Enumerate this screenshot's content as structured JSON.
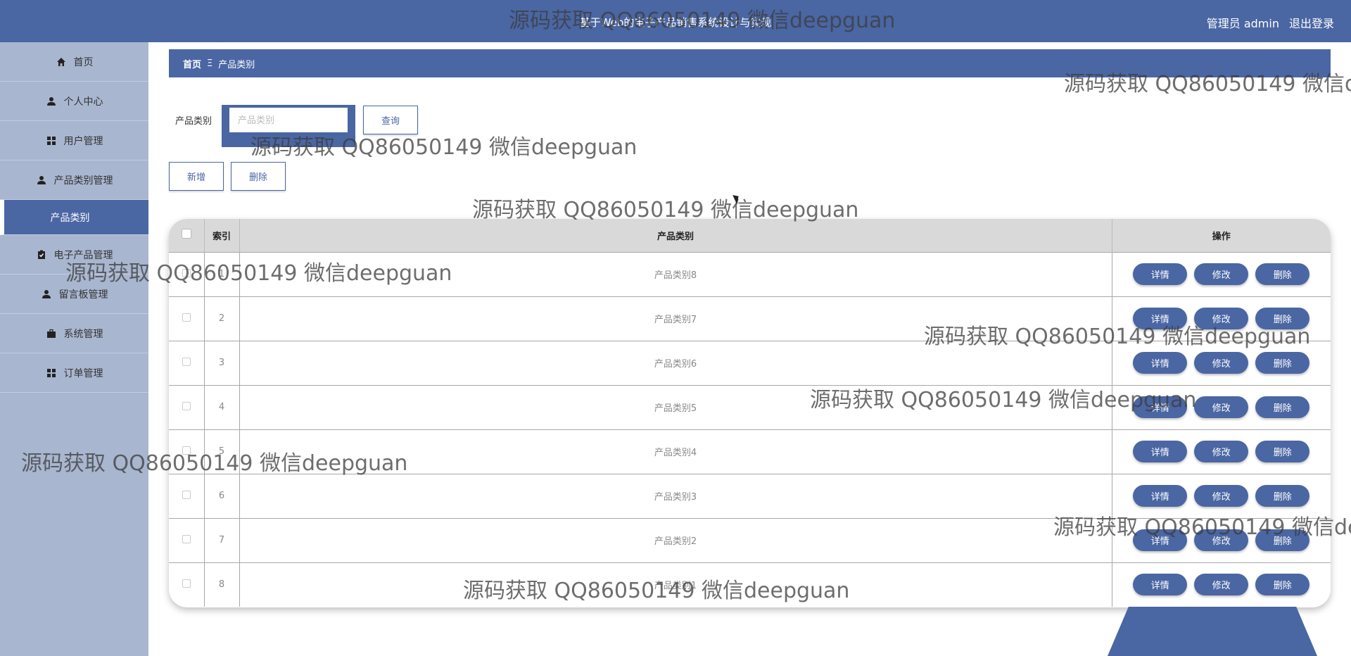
{
  "header": {
    "title": "基于Web的电子产品销售系统设计与实现",
    "user": "管理员 admin",
    "logout": "退出登录"
  },
  "sidebar": {
    "items": [
      {
        "label": "首页",
        "icon": "home-icon"
      },
      {
        "label": "个人中心",
        "icon": "user-icon"
      },
      {
        "label": "用户管理",
        "icon": "grid-icon"
      },
      {
        "label": "产品类别管理",
        "icon": "user-icon"
      },
      {
        "label": "产品类别",
        "icon": "",
        "active": true
      },
      {
        "label": "电子产品管理",
        "icon": "clipboard-icon"
      },
      {
        "label": "留言板管理",
        "icon": "user-icon"
      },
      {
        "label": "系统管理",
        "icon": "briefcase-icon"
      },
      {
        "label": "订单管理",
        "icon": "grid-icon"
      }
    ]
  },
  "breadcrumb": {
    "home": "首页",
    "separator": "Ξ",
    "current": "产品类别"
  },
  "search": {
    "label": "产品类别",
    "placeholder": "产品类别",
    "value": "",
    "query_button": "查询"
  },
  "actions": {
    "add": "新增",
    "delete": "删除"
  },
  "table": {
    "headers": {
      "index": "索引",
      "category": "产品类别",
      "ops": "操作"
    },
    "row_buttons": {
      "detail": "详情",
      "edit": "修改",
      "delete": "删除"
    },
    "rows": [
      {
        "index": "1",
        "category": "产品类别8"
      },
      {
        "index": "2",
        "category": "产品类别7"
      },
      {
        "index": "3",
        "category": "产品类别6"
      },
      {
        "index": "4",
        "category": "产品类别5"
      },
      {
        "index": "5",
        "category": "产品类别4"
      },
      {
        "index": "6",
        "category": "产品类别3"
      },
      {
        "index": "7",
        "category": "产品类别2"
      },
      {
        "index": "8",
        "category": "产品类别1"
      }
    ]
  },
  "watermark": "源码获取 QQ86050149 微信deepguan",
  "colors": {
    "primary": "#4a66a3",
    "sidebar": "#a9b6d0",
    "table_header": "#d9d9d9"
  }
}
